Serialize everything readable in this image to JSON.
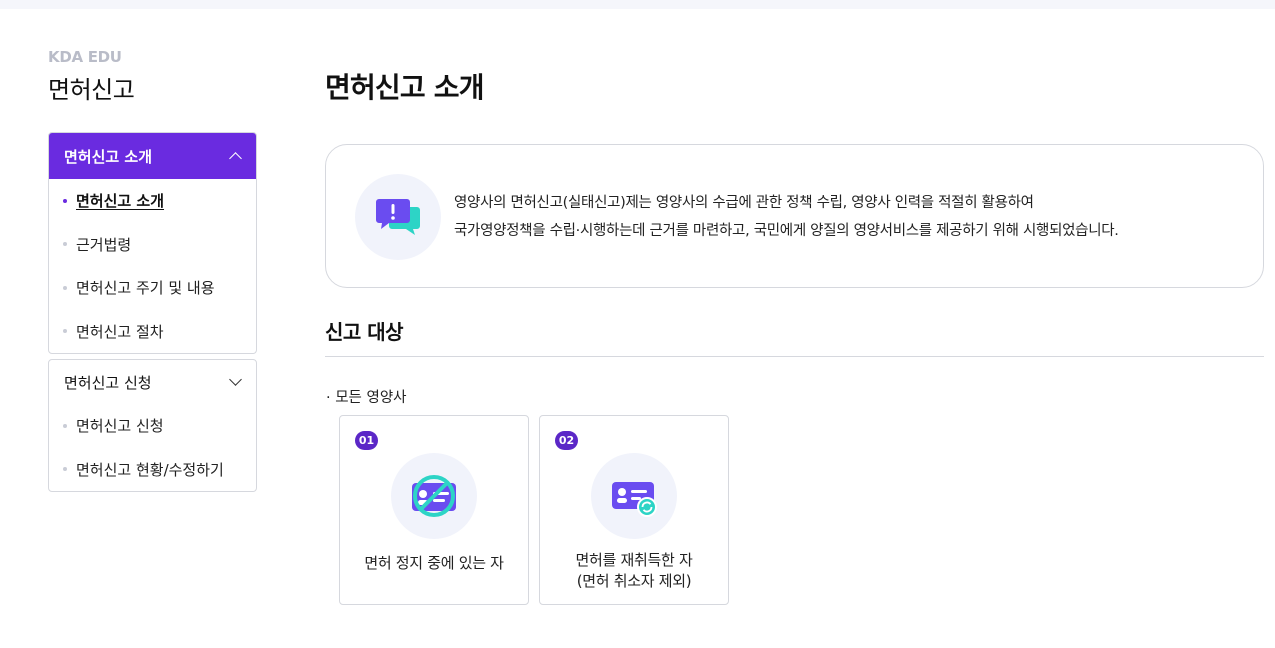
{
  "sidebar": {
    "brand": "KDA EDU",
    "title": "면허신고",
    "groups": [
      {
        "label": "면허신고 소개",
        "expanded": true,
        "items": [
          {
            "label": "면허신고 소개",
            "active": true
          },
          {
            "label": "근거법령"
          },
          {
            "label": "면허신고 주기 및 내용"
          },
          {
            "label": "면허신고 절차"
          }
        ]
      },
      {
        "label": "면허신고 신청",
        "expanded": true,
        "items": [
          {
            "label": "면허신고 신청"
          },
          {
            "label": "면허신고 현황/수정하기"
          }
        ]
      }
    ]
  },
  "main": {
    "title": "면허신고 소개",
    "intro": {
      "icon": "alert-chat-icon",
      "line1": "영양사의 면허신고(실태신고)제는 영양사의 수급에 관한 정책 수립, 영양사 인력을 적절히 활용하여",
      "line2": "국가영양정책을 수립·시행하는데 근거를 마련하고, 국민에게 양질의 영양서비스를 제공하기 위해 시행되었습니다."
    },
    "section_title": "신고 대상",
    "target_label": "·  모든 영양사",
    "cards": [
      {
        "badge": "01",
        "icon": "license-suspended-icon",
        "line1": "면허 정지 중에 있는 자",
        "line2": ""
      },
      {
        "badge": "02",
        "icon": "license-renewed-icon",
        "line1": "면허를 재취득한 자",
        "line2": "(면허 취소자 제외)"
      }
    ]
  },
  "colors": {
    "accent": "#6a2be0",
    "badge": "#5b27c7",
    "icon_bg": "#f1f3fb",
    "teal": "#2dd4c6",
    "border": "#d6d8de"
  }
}
